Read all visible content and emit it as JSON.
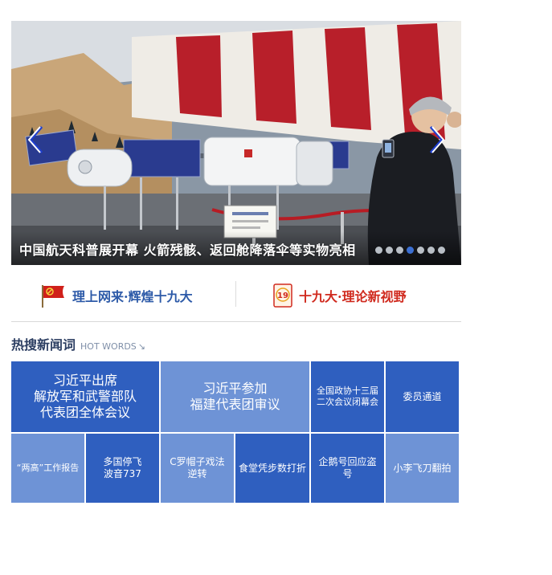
{
  "carousel": {
    "caption": "中国航天科普展开幕 火箭残骸、返回舱降落伞等实物亮相",
    "slide_count": 7,
    "active_index": 3,
    "prev_icon": "chevron-left-icon",
    "next_icon": "chevron-right-icon"
  },
  "banner": {
    "left": {
      "label": "理上网来·辉煌十九大",
      "icon": "party-flag-icon"
    },
    "right": {
      "label": "十九大·理论新视野",
      "icon": "congress-19-icon",
      "icon_text": "19"
    }
  },
  "hot_words": {
    "title": "热搜新闻词",
    "subtitle": "HOT WORDS",
    "arrow_glyph": "↘",
    "items": [
      {
        "label": "习近平出席\n解放军和武警部队\n代表团全体会议"
      },
      {
        "label": "习近平参加\n福建代表团审议"
      },
      {
        "label": "全国政协十三届\n二次会议闭幕会"
      },
      {
        "label": "委员通道"
      },
      {
        "label": "“两高”工作报告"
      },
      {
        "label": "多国停飞\n波音737"
      },
      {
        "label": "C罗帽子戏法\n逆转"
      },
      {
        "label": "食堂凭步数打折"
      },
      {
        "label": "企鹅号回应盗号"
      },
      {
        "label": "小李飞刀翻拍"
      }
    ]
  },
  "colors": {
    "tile_dark": "#2f5fbf",
    "tile_light": "#6e93d6",
    "active_dot": "#3b6fd2",
    "banner_blue": "#2d5aa8",
    "banner_red": "#d02a1e"
  }
}
